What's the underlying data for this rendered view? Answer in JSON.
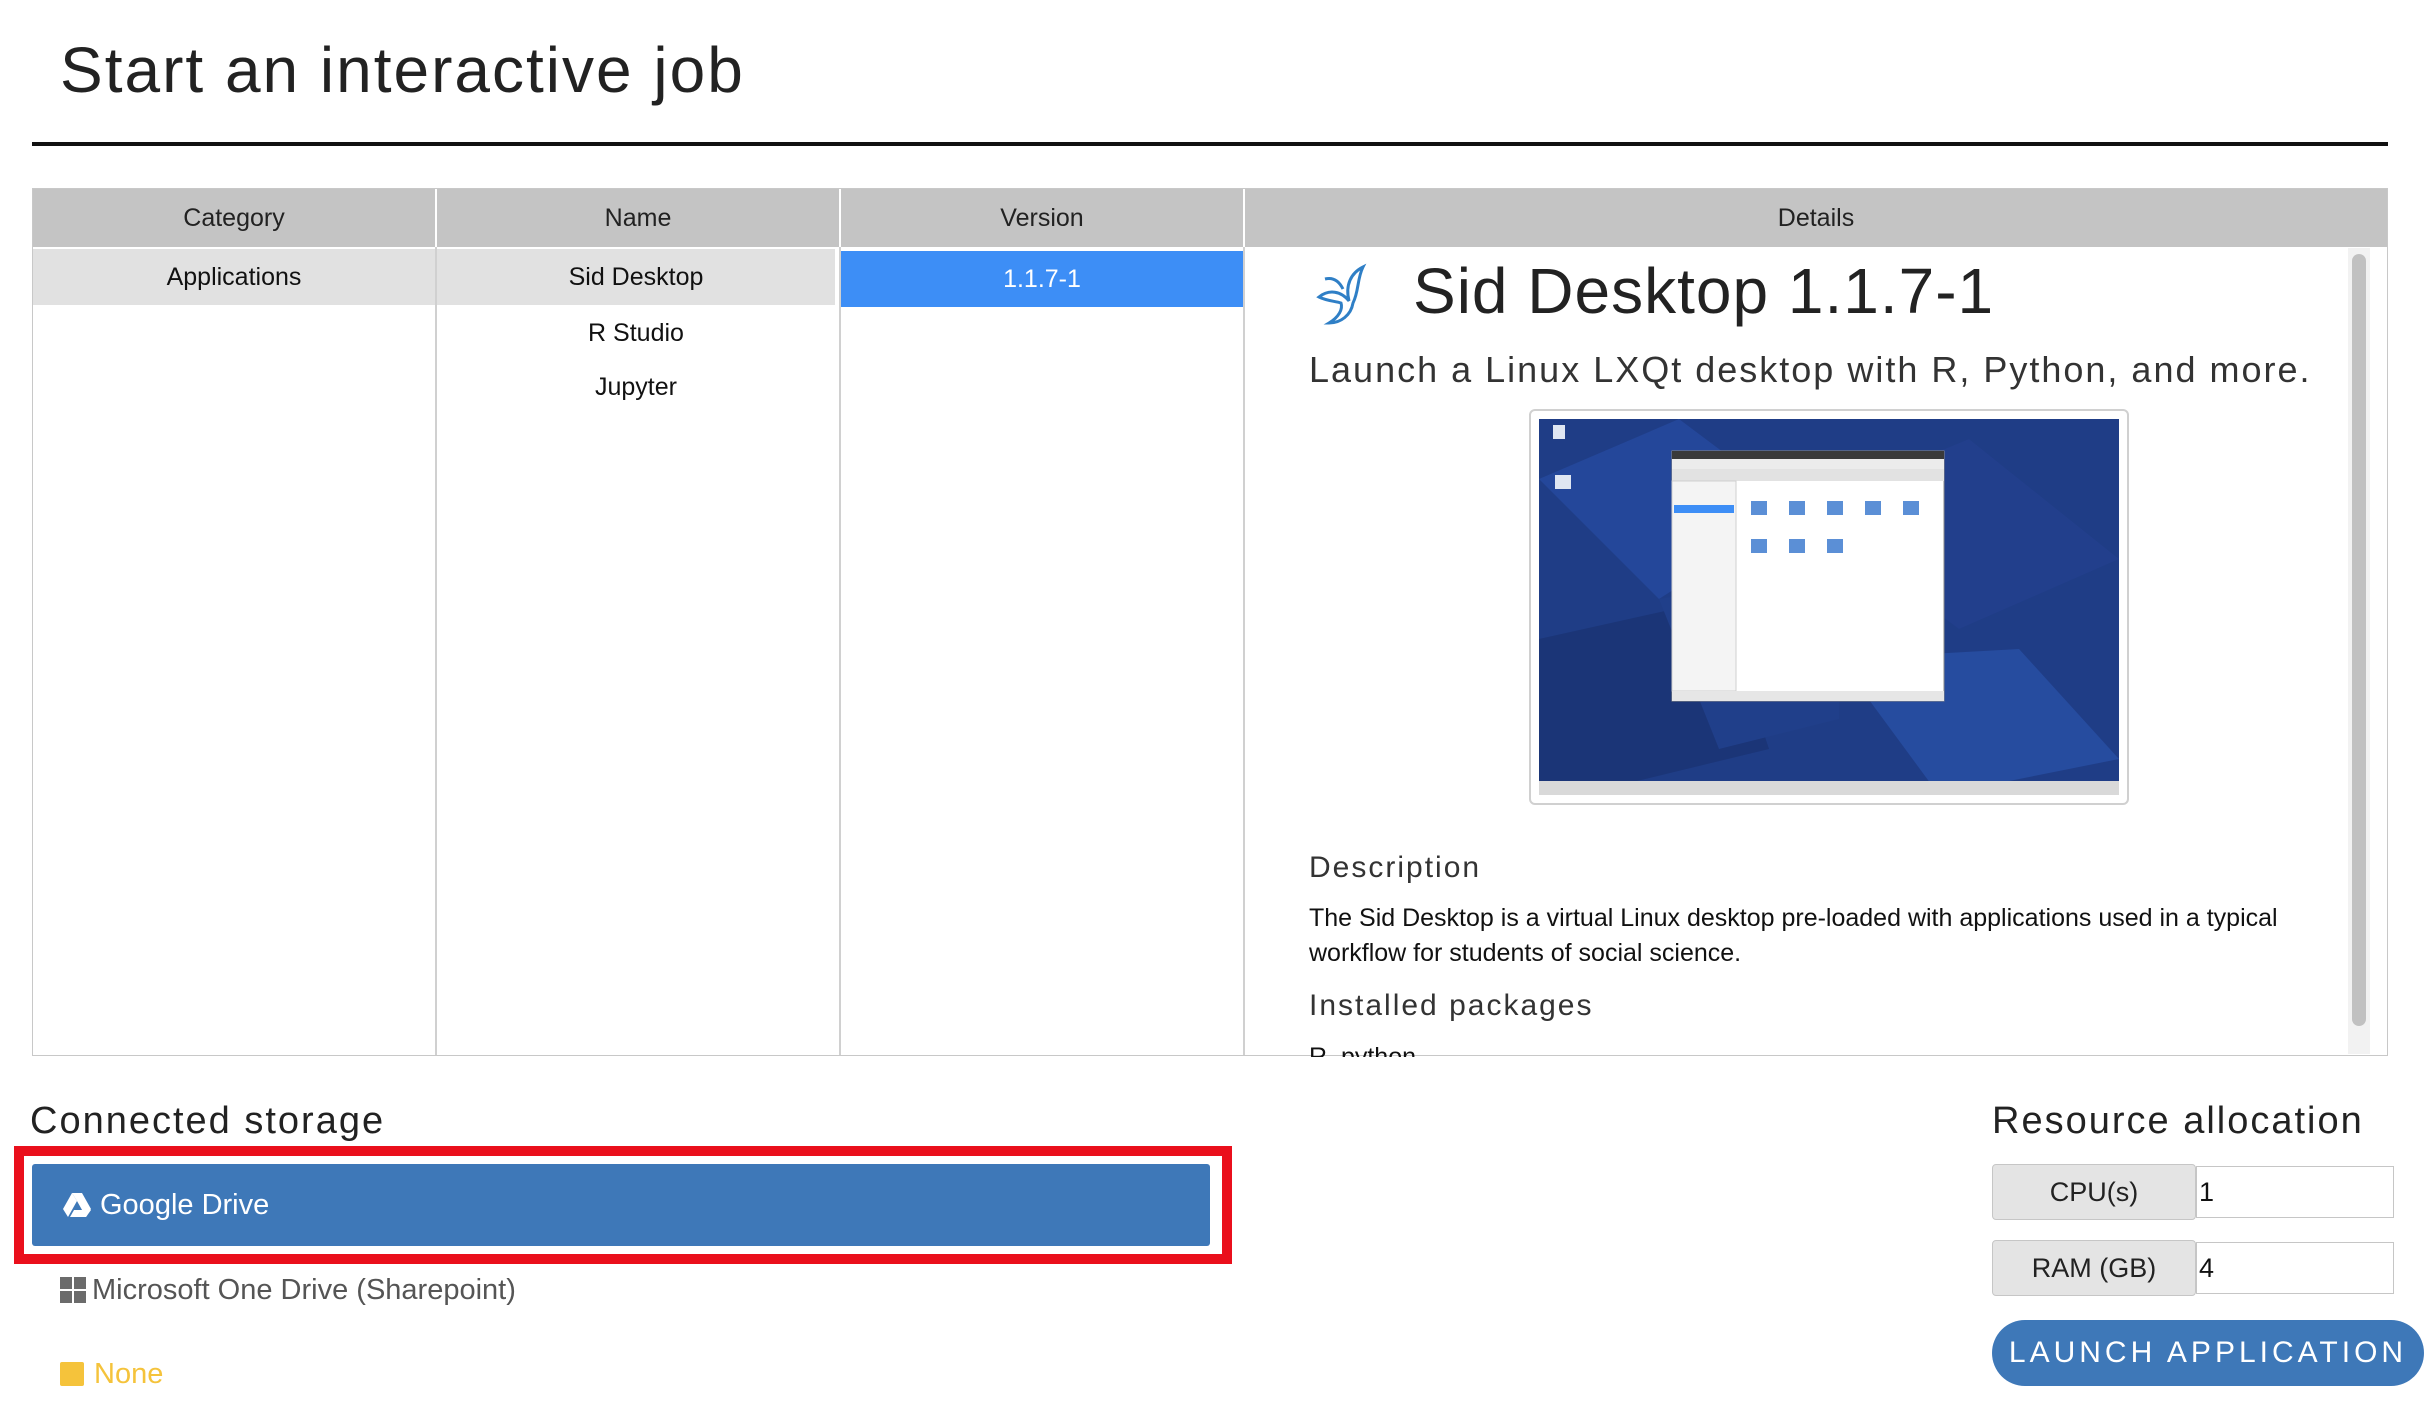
{
  "page": {
    "title": "Start an interactive job"
  },
  "table": {
    "headers": {
      "category": "Category",
      "name": "Name",
      "version": "Version",
      "details": "Details"
    },
    "categories": [
      "Applications"
    ],
    "names": [
      "Sid Desktop",
      "R Studio",
      "Jupyter"
    ],
    "versions": [
      "1.1.7-1"
    ]
  },
  "details": {
    "app_title": "Sid Desktop 1.1.7-1",
    "subtitle": "Launch a Linux LXQt desktop with R, Python, and more.",
    "description_heading": "Description",
    "description": "The Sid Desktop is a virtual Linux desktop pre-loaded with applications used in a typical workflow for students of social science.",
    "packages_heading": "Installed packages",
    "packages_partial": "R, python",
    "logo_icon": "bird-logo-icon"
  },
  "storage": {
    "heading": "Connected storage",
    "options": [
      {
        "label": "Google Drive",
        "icon": "google-drive-icon",
        "selected": true
      },
      {
        "label": "Microsoft One Drive (Sharepoint)",
        "icon": "windows-icon",
        "selected": false
      },
      {
        "label": "None",
        "icon": "yellow-square-icon",
        "selected": false
      }
    ]
  },
  "resources": {
    "heading": "Resource allocation",
    "cpu_label": "CPU(s)",
    "cpu_value": "1",
    "ram_label": "RAM (GB)",
    "ram_value": "4"
  },
  "launch_label": "LAUNCH APPLICATION",
  "colors": {
    "selected_version": "#3d8ef6",
    "primary_button": "#3e78b8",
    "highlight_box": "#ea0f1c",
    "none_option": "#f5c33b"
  }
}
